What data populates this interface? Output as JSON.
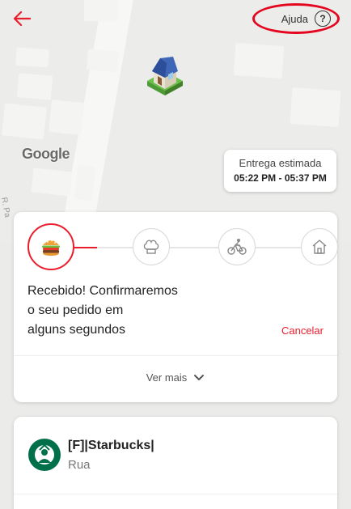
{
  "header": {
    "back_icon": "arrow-left-icon",
    "help_label": "Ajuda",
    "help_icon": "question-circle-icon"
  },
  "map": {
    "attribution": "Google",
    "street_label": "R. Pa",
    "marker_icon": "house-icon"
  },
  "eta": {
    "label": "Entrega estimada",
    "window": "05:22 PM - 05:37 PM"
  },
  "status": {
    "steps": [
      {
        "icon": "burger-icon",
        "active": true
      },
      {
        "icon": "chef-hat-icon",
        "active": false
      },
      {
        "icon": "delivery-bike-icon",
        "active": false
      },
      {
        "icon": "home-icon",
        "active": false
      }
    ],
    "line1": "Recebido! Confirmaremos",
    "line2": "o seu pedido em",
    "line3": "alguns segundos",
    "cancel_label": "Cancelar",
    "more_label": "Ver mais",
    "more_icon": "chevron-down-icon"
  },
  "store": {
    "name": "[F]|Starbucks|",
    "subtitle": "Rua",
    "logo_icon": "starbucks-logo-icon"
  },
  "colors": {
    "accent": "#ea1d2c",
    "highlight_ring": "#e4071f",
    "store_logo": "#00704a"
  }
}
